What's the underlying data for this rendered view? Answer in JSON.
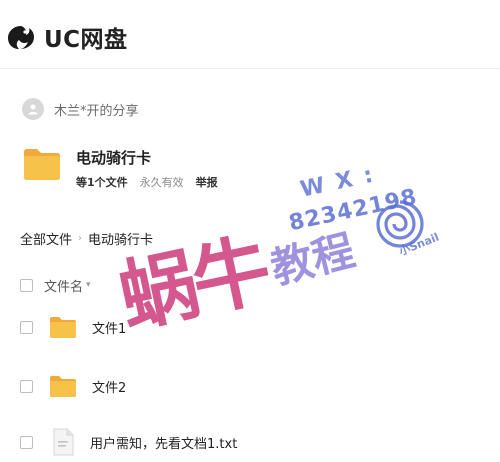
{
  "app": {
    "name": "UC网盘"
  },
  "share": {
    "sharer_label": "木兰*开的分享",
    "title": "电动骑行卡",
    "file_count": "等1个文件",
    "validity": "永久有效",
    "report_label": "举报"
  },
  "breadcrumb": {
    "root": "全部文件",
    "current": "电动骑行卡"
  },
  "list": {
    "column_name": "文件名",
    "items": [
      {
        "name": "文件1",
        "type": "folder"
      },
      {
        "name": "文件2",
        "type": "folder"
      },
      {
        "name": "用户需知，先看文档1.txt",
        "type": "txt"
      }
    ]
  },
  "watermark": {
    "main": "蜗牛",
    "sub": "教程",
    "wx_label": "W X :",
    "wx_number": "82342198",
    "mini": "小Snail"
  },
  "colors": {
    "folder": "#f7c24a",
    "folder_back": "#f2a93b",
    "accent": "#c8286e",
    "watermark_blue": "#5a6ed2"
  }
}
